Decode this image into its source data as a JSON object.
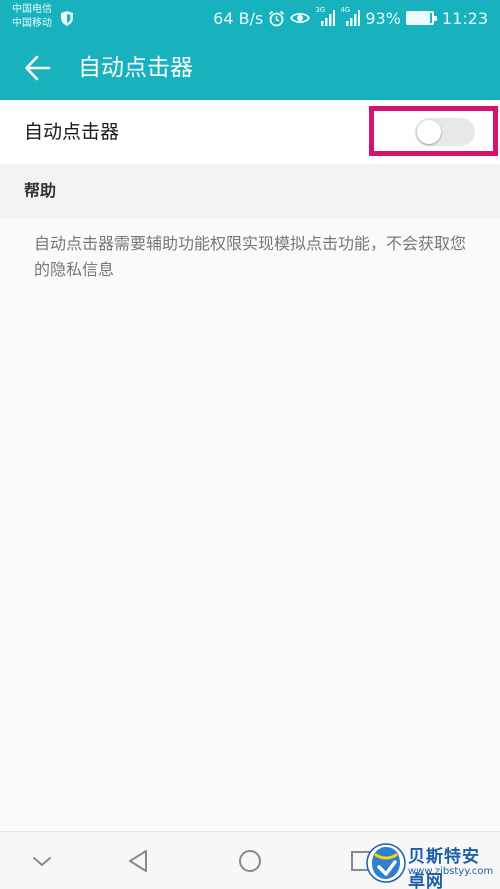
{
  "status_bar": {
    "carrier1": "中国电信",
    "carrier2": "中国移动",
    "net_speed": "64 B/s",
    "network1": "3G",
    "network2": "4G",
    "battery": "93%",
    "battery_level": 0.93,
    "time": "11:23"
  },
  "app_bar": {
    "title": "自动点击器"
  },
  "toggle_row": {
    "label": "自动点击器",
    "enabled": false
  },
  "help": {
    "title": "帮助",
    "text": "自动点击器需要辅助功能权限实现模拟点击功能，不会获取您的隐私信息"
  },
  "watermark": {
    "line1": "贝斯特安卓网",
    "line2": "www.zjbstyy.com"
  },
  "colors": {
    "primary": "#17b2bd",
    "highlight": "#d2136f"
  }
}
